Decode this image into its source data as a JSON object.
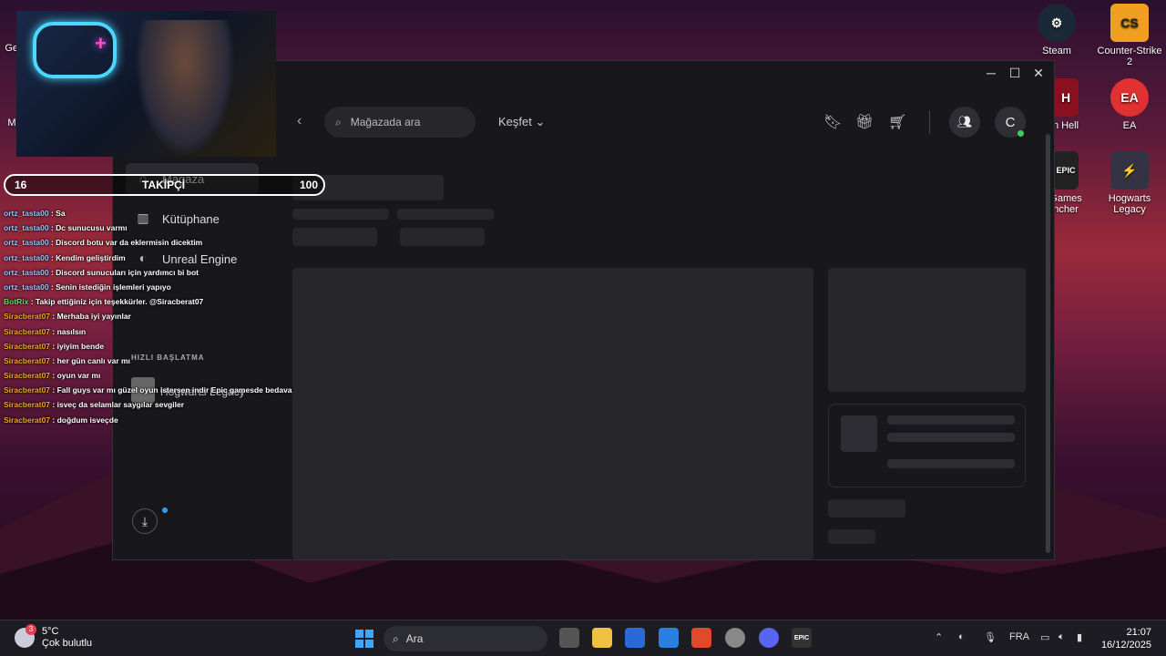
{
  "desktop": {
    "icons": [
      {
        "label": "Steam",
        "icon": "steam-icon",
        "color": "#1b2838"
      },
      {
        "label": "Counter-Strike 2",
        "icon": "cs2-icon",
        "color": "#f0a020"
      },
      {
        "label": "n Hell",
        "icon": "game-icon",
        "color": "#8a1020"
      },
      {
        "label": "EA",
        "icon": "ea-icon",
        "color": "#e03030"
      },
      {
        "label": "Games\nncher",
        "icon": "epic-games-icon",
        "color": "#222"
      },
      {
        "label": "Hogwarts Legacy",
        "icon": "hogwarts-icon",
        "color": "#334"
      }
    ],
    "left_labels": {
      "ge": "Ge",
      "mi": "Mi"
    }
  },
  "epic": {
    "window_controls": {
      "minimize": "─",
      "maximize": "☐",
      "close": "✕"
    },
    "sidebar": {
      "items": [
        {
          "label": "Mağaza",
          "icon": "store-icon",
          "glyph": "⌂"
        },
        {
          "label": "Kütüphane",
          "icon": "library-icon",
          "glyph": "▥"
        },
        {
          "label": "Unreal Engine",
          "icon": "unreal-icon",
          "glyph": "◐"
        }
      ],
      "quick_launch_title": "HIZLI BAŞLATMA",
      "quick_launch_item": "Hogwarts Legacy"
    },
    "topbar": {
      "search_placeholder": "Mağazada ara",
      "discover": "Keşfet ⌄",
      "profile_initial": "C"
    }
  },
  "overlay": {
    "follow": {
      "count": "16",
      "label": "TAKİPÇİ",
      "goal": "100"
    },
    "chat": [
      {
        "user": "ortz_tasta00",
        "type": "u",
        "msg": " : Sa"
      },
      {
        "user": "ortz_tasta00",
        "type": "u",
        "msg": " : Dc sunucusu varmı"
      },
      {
        "user": "ortz_tasta00",
        "type": "u",
        "msg": " : Discord botu var da eklermisin dicektim"
      },
      {
        "user": "ortz_tasta00",
        "type": "u",
        "msg": " : Kendim geliştirdim"
      },
      {
        "user": "ortz_tasta00",
        "type": "u",
        "msg": " : Discord sunucuları için yardımcı bi bot"
      },
      {
        "user": "ortz_tasta00",
        "type": "u",
        "msg": " : Senin istediğin işlemleri yapıyo"
      },
      {
        "user": "BotRix",
        "type": "b",
        "msg": " : Takip ettiğiniz için teşekkürler. @Siracberat07"
      },
      {
        "user": "Siracberat07",
        "type": "s",
        "msg": " : Merhaba iyi yayınlar"
      },
      {
        "user": "Siracberat07",
        "type": "s",
        "msg": " : nasılsın"
      },
      {
        "user": "Siracberat07",
        "type": "s",
        "msg": " : iyiyim bende"
      },
      {
        "user": "Siracberat07",
        "type": "s",
        "msg": " : her gün canlı var mı"
      },
      {
        "user": "Siracberat07",
        "type": "s",
        "msg": " : oyun var mı"
      },
      {
        "user": "Siracberat07",
        "type": "s",
        "msg": " : Fall guys var mı güzel oyun istersen indir Epic gamesde bedava"
      },
      {
        "user": "Siracberat07",
        "type": "s",
        "msg": " : isveç da selamlar saygılar sevgiler"
      },
      {
        "user": "Siracberat07",
        "type": "s",
        "msg": " : doğdum isveçde"
      }
    ]
  },
  "taskbar": {
    "weather_temp": "5°C",
    "weather_desc": "Çok bulutlu",
    "weather_badge": "3",
    "search_label": "Ara",
    "language": "FRA",
    "time": "21:07",
    "date": "16/12/2025"
  }
}
